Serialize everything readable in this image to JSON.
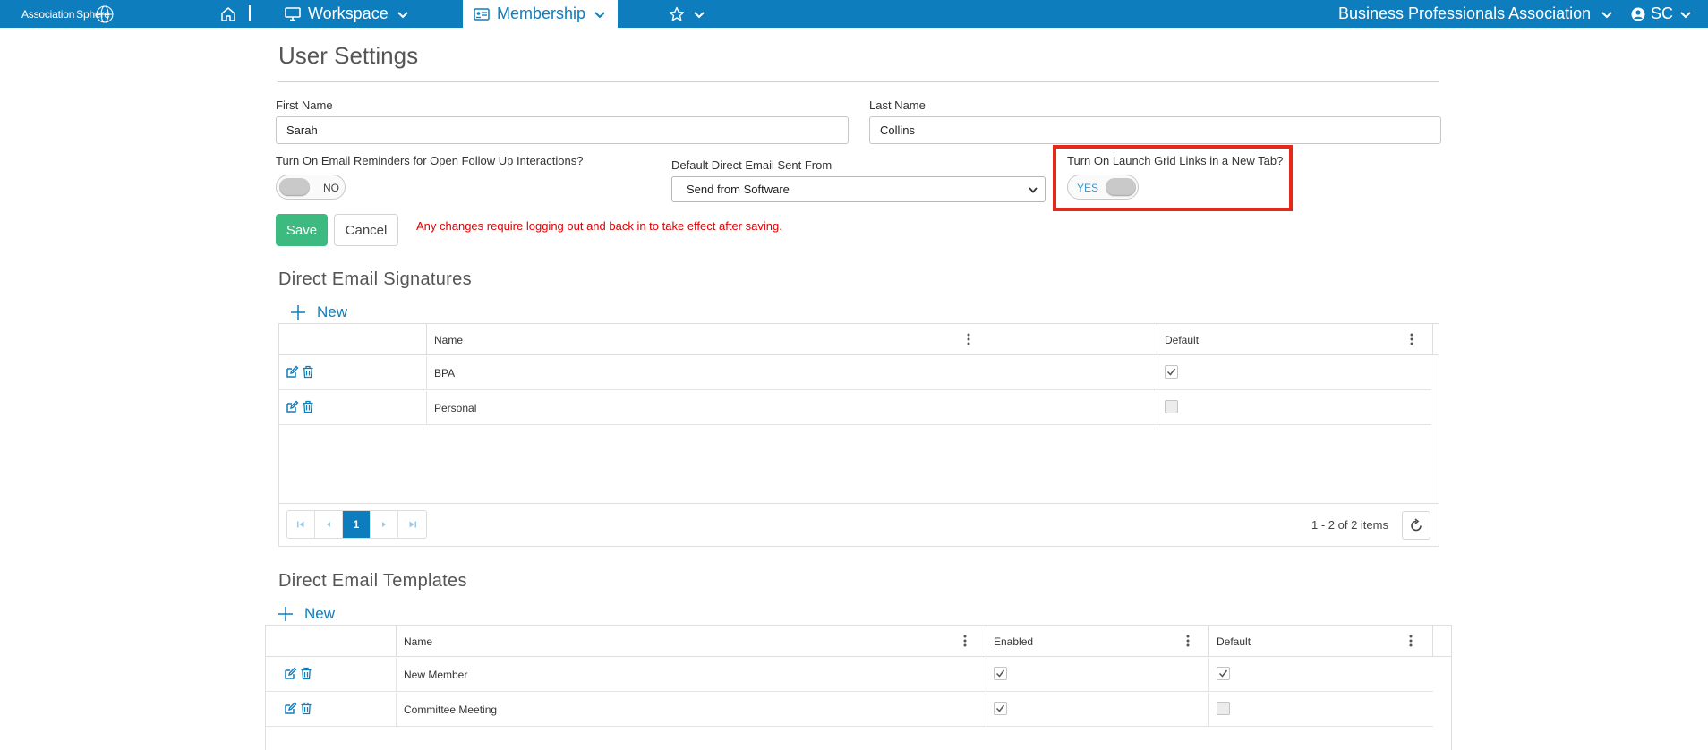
{
  "nav": {
    "logo_text_a": "Association",
    "logo_text_b": "Sphere",
    "workspace": "Workspace",
    "membership": "Membership",
    "org": "Business Professionals Association",
    "user_initials": "SC",
    "icons": [
      "home-icon",
      "monitor-icon",
      "id-card-icon",
      "star-icon",
      "user-circle-icon",
      "chevron-down-icon"
    ]
  },
  "page": {
    "title": "User Settings"
  },
  "form": {
    "first_name_label": "First Name",
    "first_name_value": "Sarah",
    "last_name_label": "Last Name",
    "last_name_value": "Collins",
    "email_reminder_label": "Turn On Email Reminders for Open Follow Up Interactions?",
    "email_reminder_state": "NO",
    "direct_email_label": "Default Direct Email Sent From",
    "direct_email_value": "Send from Software",
    "grid_links_label": "Turn On Launch Grid Links in a New Tab?",
    "grid_links_state": "YES",
    "save_label": "Save",
    "cancel_label": "Cancel",
    "warning": "Any changes require logging out and back in to take effect after saving."
  },
  "signatures": {
    "title": "Direct Email Signatures",
    "new_label": "New",
    "columns": {
      "name": "Name",
      "default": "Default"
    },
    "rows": [
      {
        "name": "BPA",
        "default": true
      },
      {
        "name": "Personal",
        "default": false
      }
    ],
    "pager": {
      "current_page": "1",
      "items_text": "1 - 2 of 2 items"
    }
  },
  "templates": {
    "title": "Direct Email Templates",
    "new_label": "New",
    "columns": {
      "name": "Name",
      "enabled": "Enabled",
      "default": "Default"
    },
    "rows": [
      {
        "name": "New Member",
        "enabled": true,
        "default": true
      },
      {
        "name": "Committee Meeting",
        "enabled": true,
        "default": false
      }
    ]
  },
  "colors": {
    "brand_blue": "#0e7dbd",
    "save_green": "#3dba7f",
    "warning_red": "#e00000",
    "highlight_red": "#e42819"
  }
}
